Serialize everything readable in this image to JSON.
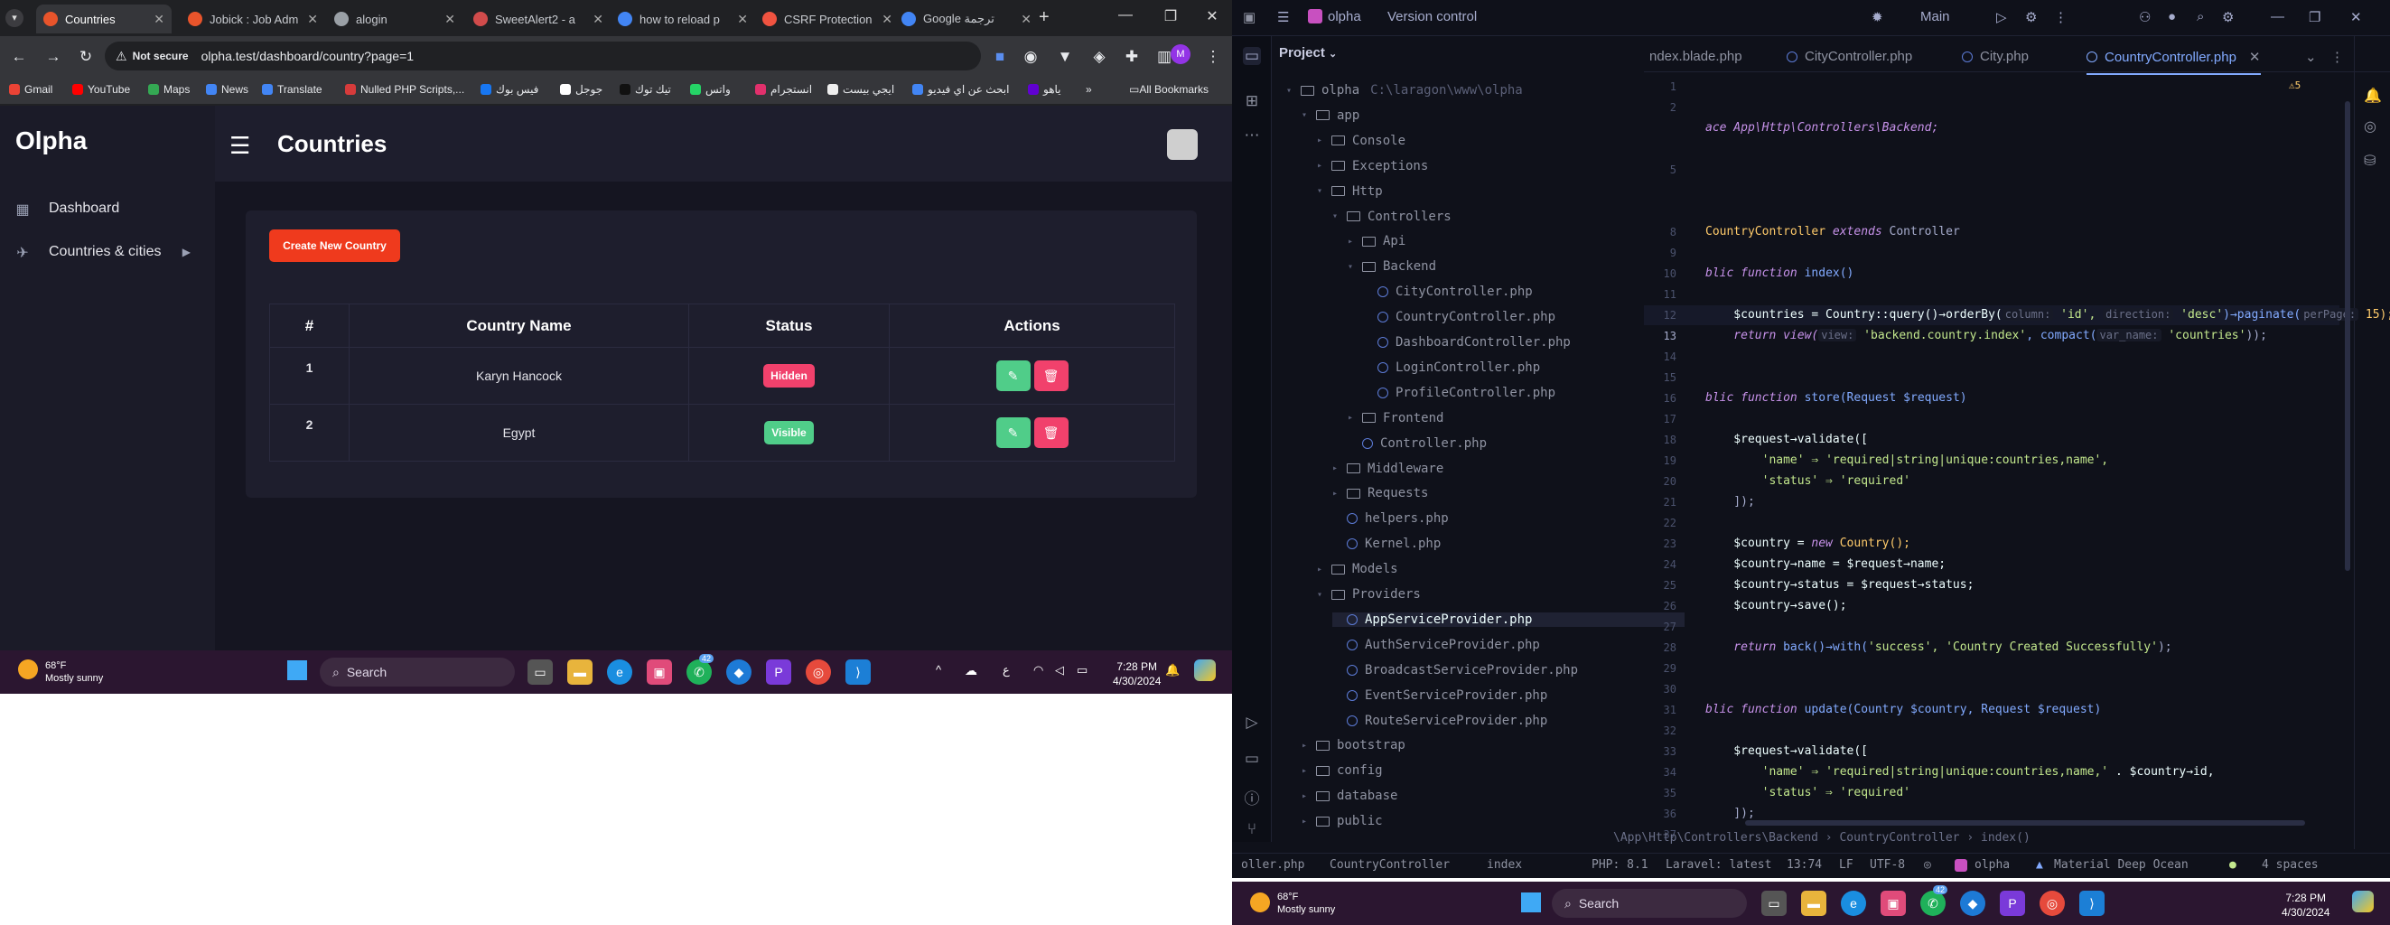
{
  "browser": {
    "tabs": [
      {
        "label": "Countries",
        "color": "#e8542b"
      },
      {
        "label": "Jobick : Job Adm",
        "color": "#e8542b"
      },
      {
        "label": "alogin",
        "color": "#9aa0a6"
      },
      {
        "label": "SweetAlert2 - a",
        "color": "#d14b4b"
      },
      {
        "label": "how to reload p",
        "color": "#4285f4"
      },
      {
        "label": "CSRF Protection",
        "color": "#f05340"
      },
      {
        "label": "Google ترجمة",
        "color": "#4285f4"
      }
    ],
    "new_tab": "+",
    "url": "olpha.test/dashboard/country?page=1",
    "not_secure": "Not secure",
    "bookmarks": [
      {
        "label": "Gmail",
        "color": "#ea4335"
      },
      {
        "label": "YouTube",
        "color": "#ff0000"
      },
      {
        "label": "Maps",
        "color": "#34a853"
      },
      {
        "label": "News",
        "color": "#4285f4"
      },
      {
        "label": "Translate",
        "color": "#4285f4"
      },
      {
        "label": "Nulled PHP Scripts,...",
        "color": "#d63b3b"
      },
      {
        "label": "فيس بوك",
        "color": "#1877f2"
      },
      {
        "label": "جوجل",
        "color": "#ffffff"
      },
      {
        "label": "تيك توك",
        "color": "#111111"
      },
      {
        "label": "واتس",
        "color": "#25d366"
      },
      {
        "label": "انستجرام",
        "color": "#e1306c"
      },
      {
        "label": "ايجي بيست",
        "color": "#eeeeee"
      },
      {
        "label": "ابحث عن اي فيديو",
        "color": "#4285f4"
      },
      {
        "label": "ياهو",
        "color": "#6001d2"
      }
    ],
    "bookmarks_more": "»",
    "all_bookmarks": "All Bookmarks"
  },
  "app": {
    "logo": "Olpha",
    "page_title": "Countries",
    "sidebar": [
      {
        "label": "Dashboard",
        "icon": "grid-icon"
      },
      {
        "label": "Countries & cities",
        "icon": "rocket-icon"
      }
    ],
    "create_button": "Create New Country",
    "table": {
      "headers": [
        "#",
        "Country Name",
        "Status",
        "Actions"
      ],
      "rows": [
        {
          "id": "1",
          "name": "Karyn Hancock",
          "status": "Hidden",
          "status_color": "#f1416c"
        },
        {
          "id": "2",
          "name": "Egypt",
          "status": "Visible",
          "status_color": "#50cd89"
        }
      ]
    },
    "colors": {
      "edit": "#50cd89",
      "delete": "#f1416c",
      "create": "#ef3a1d"
    }
  },
  "taskbar": {
    "temp": "68°F",
    "weather": "Mostly sunny",
    "search": "Search",
    "time": "7:28 PM",
    "date": "4/30/2024",
    "badge": "42",
    "lang": "ع"
  },
  "ide": {
    "project": "olpha",
    "vcs": "Version control",
    "branch": "Main",
    "panel": "Project",
    "root_path": "C:\\laragon\\www\\olpha",
    "tree": [
      {
        "label": "olpha",
        "type": "folder",
        "depth": 0,
        "arrow": "▾"
      },
      {
        "label": "app",
        "type": "folder",
        "depth": 1,
        "arrow": "▾"
      },
      {
        "label": "Console",
        "type": "folder",
        "depth": 2,
        "arrow": "▸"
      },
      {
        "label": "Exceptions",
        "type": "folder",
        "depth": 2,
        "arrow": "▸"
      },
      {
        "label": "Http",
        "type": "folder",
        "depth": 2,
        "arrow": "▾"
      },
      {
        "label": "Controllers",
        "type": "folder",
        "depth": 3,
        "arrow": "▾"
      },
      {
        "label": "Api",
        "type": "folder",
        "depth": 4,
        "arrow": "▸"
      },
      {
        "label": "Backend",
        "type": "folder",
        "depth": 4,
        "arrow": "▾"
      },
      {
        "label": "CityController.php",
        "type": "php",
        "depth": 5,
        "arrow": ""
      },
      {
        "label": "CountryController.php",
        "type": "php",
        "depth": 5,
        "arrow": ""
      },
      {
        "label": "DashboardController.php",
        "type": "php",
        "depth": 5,
        "arrow": ""
      },
      {
        "label": "LoginController.php",
        "type": "php",
        "depth": 5,
        "arrow": ""
      },
      {
        "label": "ProfileController.php",
        "type": "php",
        "depth": 5,
        "arrow": ""
      },
      {
        "label": "Frontend",
        "type": "folder",
        "depth": 4,
        "arrow": "▸"
      },
      {
        "label": "Controller.php",
        "type": "php",
        "depth": 4,
        "arrow": ""
      },
      {
        "label": "Middleware",
        "type": "folder",
        "depth": 3,
        "arrow": "▸"
      },
      {
        "label": "Requests",
        "type": "folder",
        "depth": 3,
        "arrow": "▸"
      },
      {
        "label": "helpers.php",
        "type": "php",
        "depth": 3,
        "arrow": ""
      },
      {
        "label": "Kernel.php",
        "type": "php",
        "depth": 3,
        "arrow": ""
      },
      {
        "label": "Models",
        "type": "folder",
        "depth": 2,
        "arrow": "▸"
      },
      {
        "label": "Providers",
        "type": "folder",
        "depth": 2,
        "arrow": "▾"
      },
      {
        "label": "AppServiceProvider.php",
        "type": "php",
        "depth": 3,
        "arrow": ""
      },
      {
        "label": "AuthServiceProvider.php",
        "type": "php",
        "depth": 3,
        "arrow": ""
      },
      {
        "label": "BroadcastServiceProvider.php",
        "type": "php",
        "depth": 3,
        "arrow": ""
      },
      {
        "label": "EventServiceProvider.php",
        "type": "php",
        "depth": 3,
        "arrow": ""
      },
      {
        "label": "RouteServiceProvider.php",
        "type": "php",
        "depth": 3,
        "arrow": ""
      },
      {
        "label": "bootstrap",
        "type": "folder",
        "depth": 1,
        "arrow": "▸"
      },
      {
        "label": "config",
        "type": "folder",
        "depth": 1,
        "arrow": "▸"
      },
      {
        "label": "database",
        "type": "folder",
        "depth": 1,
        "arrow": "▸"
      },
      {
        "label": "public",
        "type": "folder",
        "depth": 1,
        "arrow": "▸"
      }
    ],
    "editor_tabs": [
      "ndex.blade.php",
      "CityController.php",
      "City.php",
      "CountryController.php"
    ],
    "line_numbers": [
      "1",
      "2",
      "",
      "",
      "5",
      "",
      "",
      "8",
      "9",
      "10",
      "11",
      "12",
      "13",
      "14",
      "15",
      "16",
      "17",
      "18",
      "19",
      "20",
      "21",
      "22",
      "23",
      "24",
      "25",
      "26",
      "27",
      "28",
      "29",
      "30",
      "31",
      "32",
      "33",
      "34",
      "35",
      "36",
      "37"
    ],
    "code": {
      "l2": "ace App\\Http\\Controllers\\Backend;",
      "l9a": "CountryController ",
      "l9b": "extends",
      "l9c": " Controller",
      "l11a": "blic ",
      "l11b": "function",
      "l11c": " index()",
      "l13": "    $countries = Country::query()→orderBy(",
      "l13h1": "column:",
      "l13s1": " 'id', ",
      "l13h2": "direction:",
      "l13s2": " 'desc'",
      "l13c": ")→paginate(",
      "l13h3": "perPage:",
      "l13d": " 15);",
      "l14a": "    return view(",
      "l14h1": "view:",
      "l14s1": " 'backend.country.index'",
      "l14b": ", compact(",
      "l14h2": "var_name:",
      "l14s2": " 'countries'",
      "l14c": "));",
      "l17a": "blic ",
      "l17b": "function",
      "l17c": " store(Request $request)",
      "l19": "    $request→validate([",
      "l20a": "        'name' ⇒ ",
      "l20b": "'required|string|unique:countries,name',",
      "l21a": "        'status' ⇒ ",
      "l21b": "'required'",
      "l22": "    ]);",
      "l24a": "    $country = ",
      "l24b": "new",
      "l24c": " Country();",
      "l25": "    $country→name = $request→name;",
      "l26": "    $country→status = $request→status;",
      "l27": "    $country→save();",
      "l29a": "    return",
      "l29b": " back()→with(",
      "l29c": "'success', 'Country Created Successfully'",
      "l29d": ");",
      "l32a": "blic ",
      "l32b": "function",
      "l32c": " update(Country $country, Request $request)",
      "l34": "    $request→validate([",
      "l35a": "        'name' ⇒ ",
      "l35b": "'required|string|unique:countries,name,'",
      "l35c": " . $country→id,",
      "l36a": "        'status' ⇒ ",
      "l36b": "'required'",
      "l37": "    ]);"
    },
    "breadcrumb": "\\App\\Http\\Controllers\\Backend  ›  CountryController  ›  index()",
    "status": {
      "file": "oller.php",
      "cls": "CountryController",
      "method": "index",
      "php": "PHP: 8.1",
      "laravel": "Laravel: latest",
      "pos": "13:74",
      "eol": "LF",
      "enc": "UTF-8",
      "project": "olpha",
      "theme": "Material Deep Ocean",
      "indent": "4 spaces"
    },
    "warnings": "5"
  }
}
